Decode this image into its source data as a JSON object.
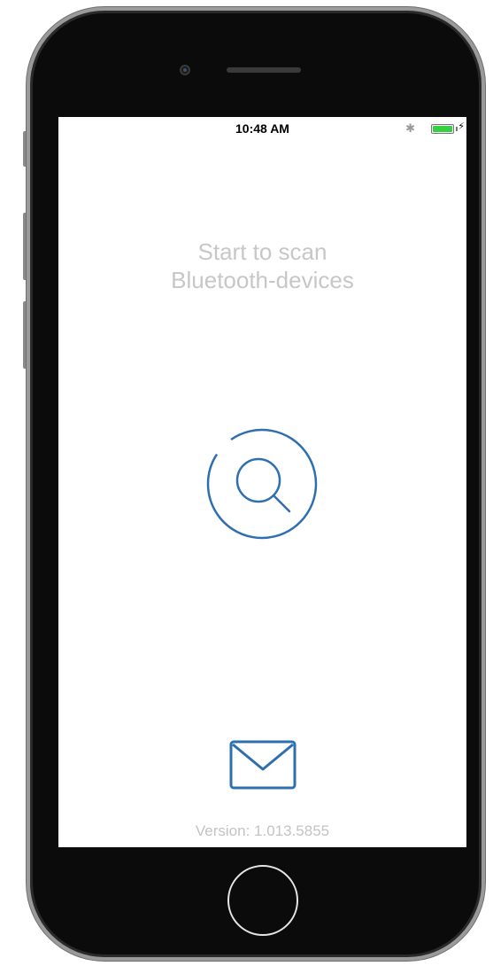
{
  "status_bar": {
    "time": "10:48 AM",
    "bluetooth_icon": "bluetooth-icon",
    "battery_icon": "battery-charging-icon",
    "battery_color": "#35d143"
  },
  "main": {
    "headline_line1": "Start to scan",
    "headline_line2": "Bluetooth-devices",
    "scan_icon": "search-icon",
    "mail_icon": "mail-icon",
    "version": "Version: 1.013.5855"
  },
  "colors": {
    "accent": "#2e6fb0",
    "headline": "#c7c7c7",
    "version_text": "#c3c3c3",
    "device_body": "#0b0b0b"
  }
}
